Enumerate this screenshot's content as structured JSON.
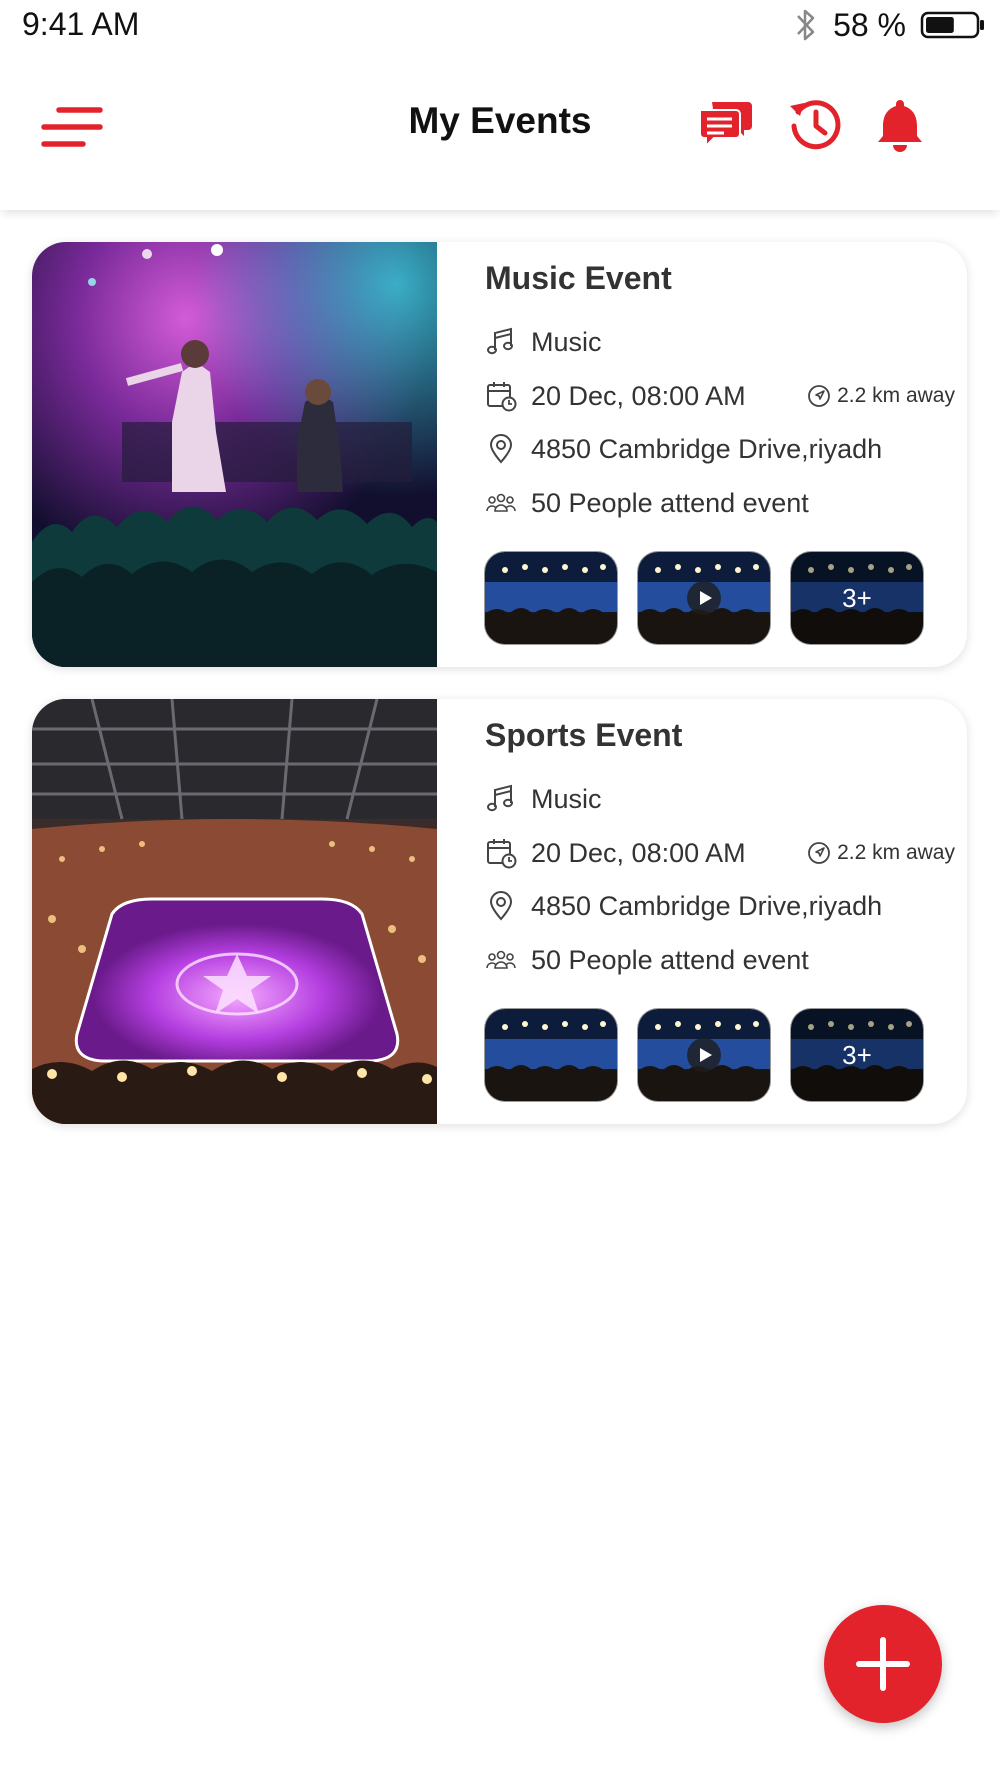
{
  "status_bar": {
    "time": "9:41 AM",
    "battery_percent": "58 %",
    "battery_level": 0.58,
    "icons": [
      "bluetooth-icon",
      "battery-icon"
    ]
  },
  "header": {
    "title": "My Events",
    "icons": [
      "menu-icon",
      "chat-icon",
      "history-icon",
      "bell-icon"
    ],
    "accent_color": "#e3232b"
  },
  "events": [
    {
      "title": "Music Event",
      "category": "Music",
      "datetime": "20 Dec, 08:00 AM",
      "distance": "2.2 km away",
      "address": "4850  Cambridge Drive,riyadh",
      "attendees": "50 People attend event",
      "image": "concert-stage-photo",
      "thumb_more": "3+"
    },
    {
      "title": "Sports Event",
      "category": "Music",
      "datetime": "20 Dec, 08:00 AM",
      "distance": "2.2 km away",
      "address": "4850  Cambridge Drive,riyadh",
      "attendees": "50 People attend event",
      "image": "arena-photo",
      "thumb_more": "3+"
    }
  ],
  "fab": {
    "icon": "plus-icon",
    "color": "#e3232b"
  }
}
